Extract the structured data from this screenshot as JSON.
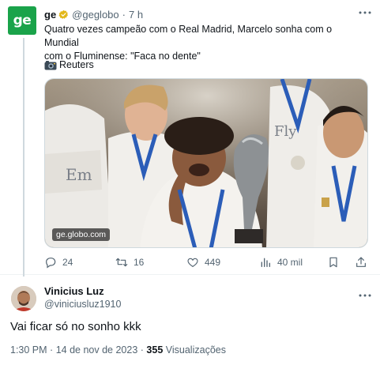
{
  "tweet": {
    "avatar_text": "ge",
    "author_name": "ge",
    "author_handle": "@geglobo",
    "separator": "·",
    "time_ago": "7 h",
    "text_line1": "Quatro vezes campeão com o Real Madrid, Marcelo sonha com o Mundial",
    "text_line2": "com o Fluminense: \"Faca no dente\"",
    "source": "Reuters",
    "source_icon": "camera-emoji-icon",
    "media_watermark": "ge.globo.com",
    "actions": {
      "replies": "24",
      "retweets": "16",
      "likes": "449",
      "views": "40 mil"
    },
    "colors": {
      "brand": "#1aa34a",
      "verified": "#e2b719",
      "muted": "#536471"
    }
  },
  "reply": {
    "author_name": "Vinicius Luz",
    "author_handle": "@viniciusluz1910",
    "text": "Vai ficar só no sonho kkk",
    "time": "1:30 PM",
    "separator": "·",
    "date": "14 de nov de 2023",
    "views_count": "355",
    "views_label": "Visualizações"
  }
}
